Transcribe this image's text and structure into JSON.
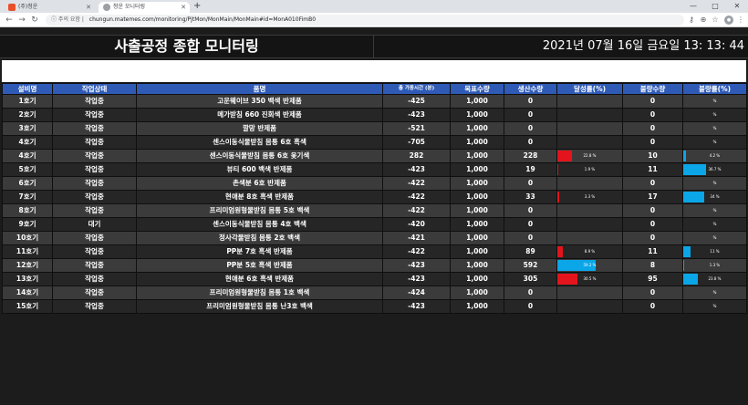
{
  "browser": {
    "tabs": [
      {
        "label": "(주)청운",
        "active": false
      },
      {
        "label": "청운 모니터링",
        "active": true
      }
    ],
    "new_tab": "+",
    "address": {
      "secure_label": "주의 요함",
      "url": "chungun.matemes.com/monitoring/PjtMon/MonMain/MonMain#id=MonA010FimB0"
    }
  },
  "header": {
    "title": "사출공정 종합 모니터링",
    "datetime": "2021년 07월 16일 금요일 13: 13: 44"
  },
  "table": {
    "columns": [
      "설비명",
      "작업상태",
      "품명",
      "총 가동시간 (분)",
      "목표수량",
      "생산수량",
      "달성률(%)",
      "불량수량",
      "불량률(%)"
    ],
    "rows": [
      {
        "machine": "1호기",
        "status": "작업중",
        "product": "고운웨이브 350 백색 반제품",
        "runtime": "-425",
        "target": "1,000",
        "produced": "0",
        "achieve": null,
        "achieve_label": "",
        "defects": "0",
        "defect_rate": null,
        "defect_label": "%"
      },
      {
        "machine": "2호기",
        "status": "작업중",
        "product": "메가받침 660 진회색 반제품",
        "runtime": "-423",
        "target": "1,000",
        "produced": "0",
        "achieve": null,
        "achieve_label": "",
        "defects": "0",
        "defect_rate": null,
        "defect_label": "%"
      },
      {
        "machine": "3호기",
        "status": "작업중",
        "product": "깔망 반제품",
        "runtime": "-521",
        "target": "1,000",
        "produced": "0",
        "achieve": null,
        "achieve_label": "",
        "defects": "0",
        "defect_rate": null,
        "defect_label": "%"
      },
      {
        "machine": "4호기",
        "status": "작업중",
        "product": "센스이동식물받침 몸통 6호 흑색",
        "runtime": "-705",
        "target": "1,000",
        "produced": "0",
        "achieve": null,
        "achieve_label": "",
        "defects": "0",
        "defect_rate": null,
        "defect_label": "%"
      },
      {
        "machine": "4호기",
        "status": "작업중",
        "product": "센스이동식물받침 몸통 6호 옻기색",
        "runtime": "282",
        "target": "1,000",
        "produced": "228",
        "achieve": 22.8,
        "achieve_label": "22.8 %",
        "defects": "10",
        "defect_rate": 4.2,
        "defect_label": "4.2 %"
      },
      {
        "machine": "5호기",
        "status": "작업중",
        "product": "뷰티 600 백색 반제품",
        "runtime": "-423",
        "target": "1,000",
        "produced": "19",
        "achieve": 1.9,
        "achieve_label": "1.9 %",
        "defects": "11",
        "defect_rate": 36.7,
        "defect_label": "36.7 %"
      },
      {
        "machine": "6호기",
        "status": "작업중",
        "product": "촌색분 6호 반제품",
        "runtime": "-422",
        "target": "1,000",
        "produced": "0",
        "achieve": null,
        "achieve_label": "",
        "defects": "0",
        "defect_rate": null,
        "defect_label": "%"
      },
      {
        "machine": "7호기",
        "status": "작업중",
        "product": "현애분 8호 흑색 반제품",
        "runtime": "-422",
        "target": "1,000",
        "produced": "33",
        "achieve": 3.3,
        "achieve_label": "3.3 %",
        "defects": "17",
        "defect_rate": 34.0,
        "defect_label": "34 %"
      },
      {
        "machine": "8호기",
        "status": "작업중",
        "product": "프리미엄원형물받침 몸통 5호 백색",
        "runtime": "-422",
        "target": "1,000",
        "produced": "0",
        "achieve": null,
        "achieve_label": "",
        "defects": "0",
        "defect_rate": null,
        "defect_label": "%"
      },
      {
        "machine": "9호기",
        "status": "대기",
        "product": "센스이동식물받침 몸통 4호 백색",
        "runtime": "-420",
        "target": "1,000",
        "produced": "0",
        "achieve": null,
        "achieve_label": "",
        "defects": "0",
        "defect_rate": null,
        "defect_label": "%"
      },
      {
        "machine": "10호기",
        "status": "작업중",
        "product": "정사각물받침 몸통 2호 백색",
        "runtime": "-421",
        "target": "1,000",
        "produced": "0",
        "achieve": null,
        "achieve_label": "",
        "defects": "0",
        "defect_rate": null,
        "defect_label": "%"
      },
      {
        "machine": "11호기",
        "status": "작업중",
        "product": "PP분 7호 흑색 반제품",
        "runtime": "-422",
        "target": "1,000",
        "produced": "89",
        "achieve": 8.9,
        "achieve_label": "8.9 %",
        "defects": "11",
        "defect_rate": 11.0,
        "defect_label": "11 %"
      },
      {
        "machine": "12호기",
        "status": "작업중",
        "product": "PP분 5호 흑색 반제품",
        "runtime": "-423",
        "target": "1,000",
        "produced": "592",
        "achieve": 59.2,
        "achieve_label": "59.2 %",
        "defects": "8",
        "defect_rate": 1.3,
        "defect_label": "1.3 %"
      },
      {
        "machine": "13호기",
        "status": "작업중",
        "product": "현애분 6호 흑색 반제품",
        "runtime": "-423",
        "target": "1,000",
        "produced": "305",
        "achieve": 30.5,
        "achieve_label": "30.5 %",
        "defects": "95",
        "defect_rate": 23.8,
        "defect_label": "23.8 %"
      },
      {
        "machine": "14호기",
        "status": "작업중",
        "product": "프리미엄원형물받침 몸통 1호 백색",
        "runtime": "-424",
        "target": "1,000",
        "produced": "0",
        "achieve": null,
        "achieve_label": "",
        "defects": "0",
        "defect_rate": null,
        "defect_label": "%"
      },
      {
        "machine": "15호기",
        "status": "작업중",
        "product": "프리미엄원형물받침 몸통 난3호 백색",
        "runtime": "-423",
        "target": "1,000",
        "produced": "0",
        "achieve": null,
        "achieve_label": "",
        "defects": "0",
        "defect_rate": null,
        "defect_label": "%"
      }
    ]
  },
  "colors": {
    "header_blue": "#2f5bb7",
    "achieve_bar": "#e3141c",
    "defect_bar": "#0aa6e8",
    "achieve_bar_high": "#0aa6e8"
  }
}
